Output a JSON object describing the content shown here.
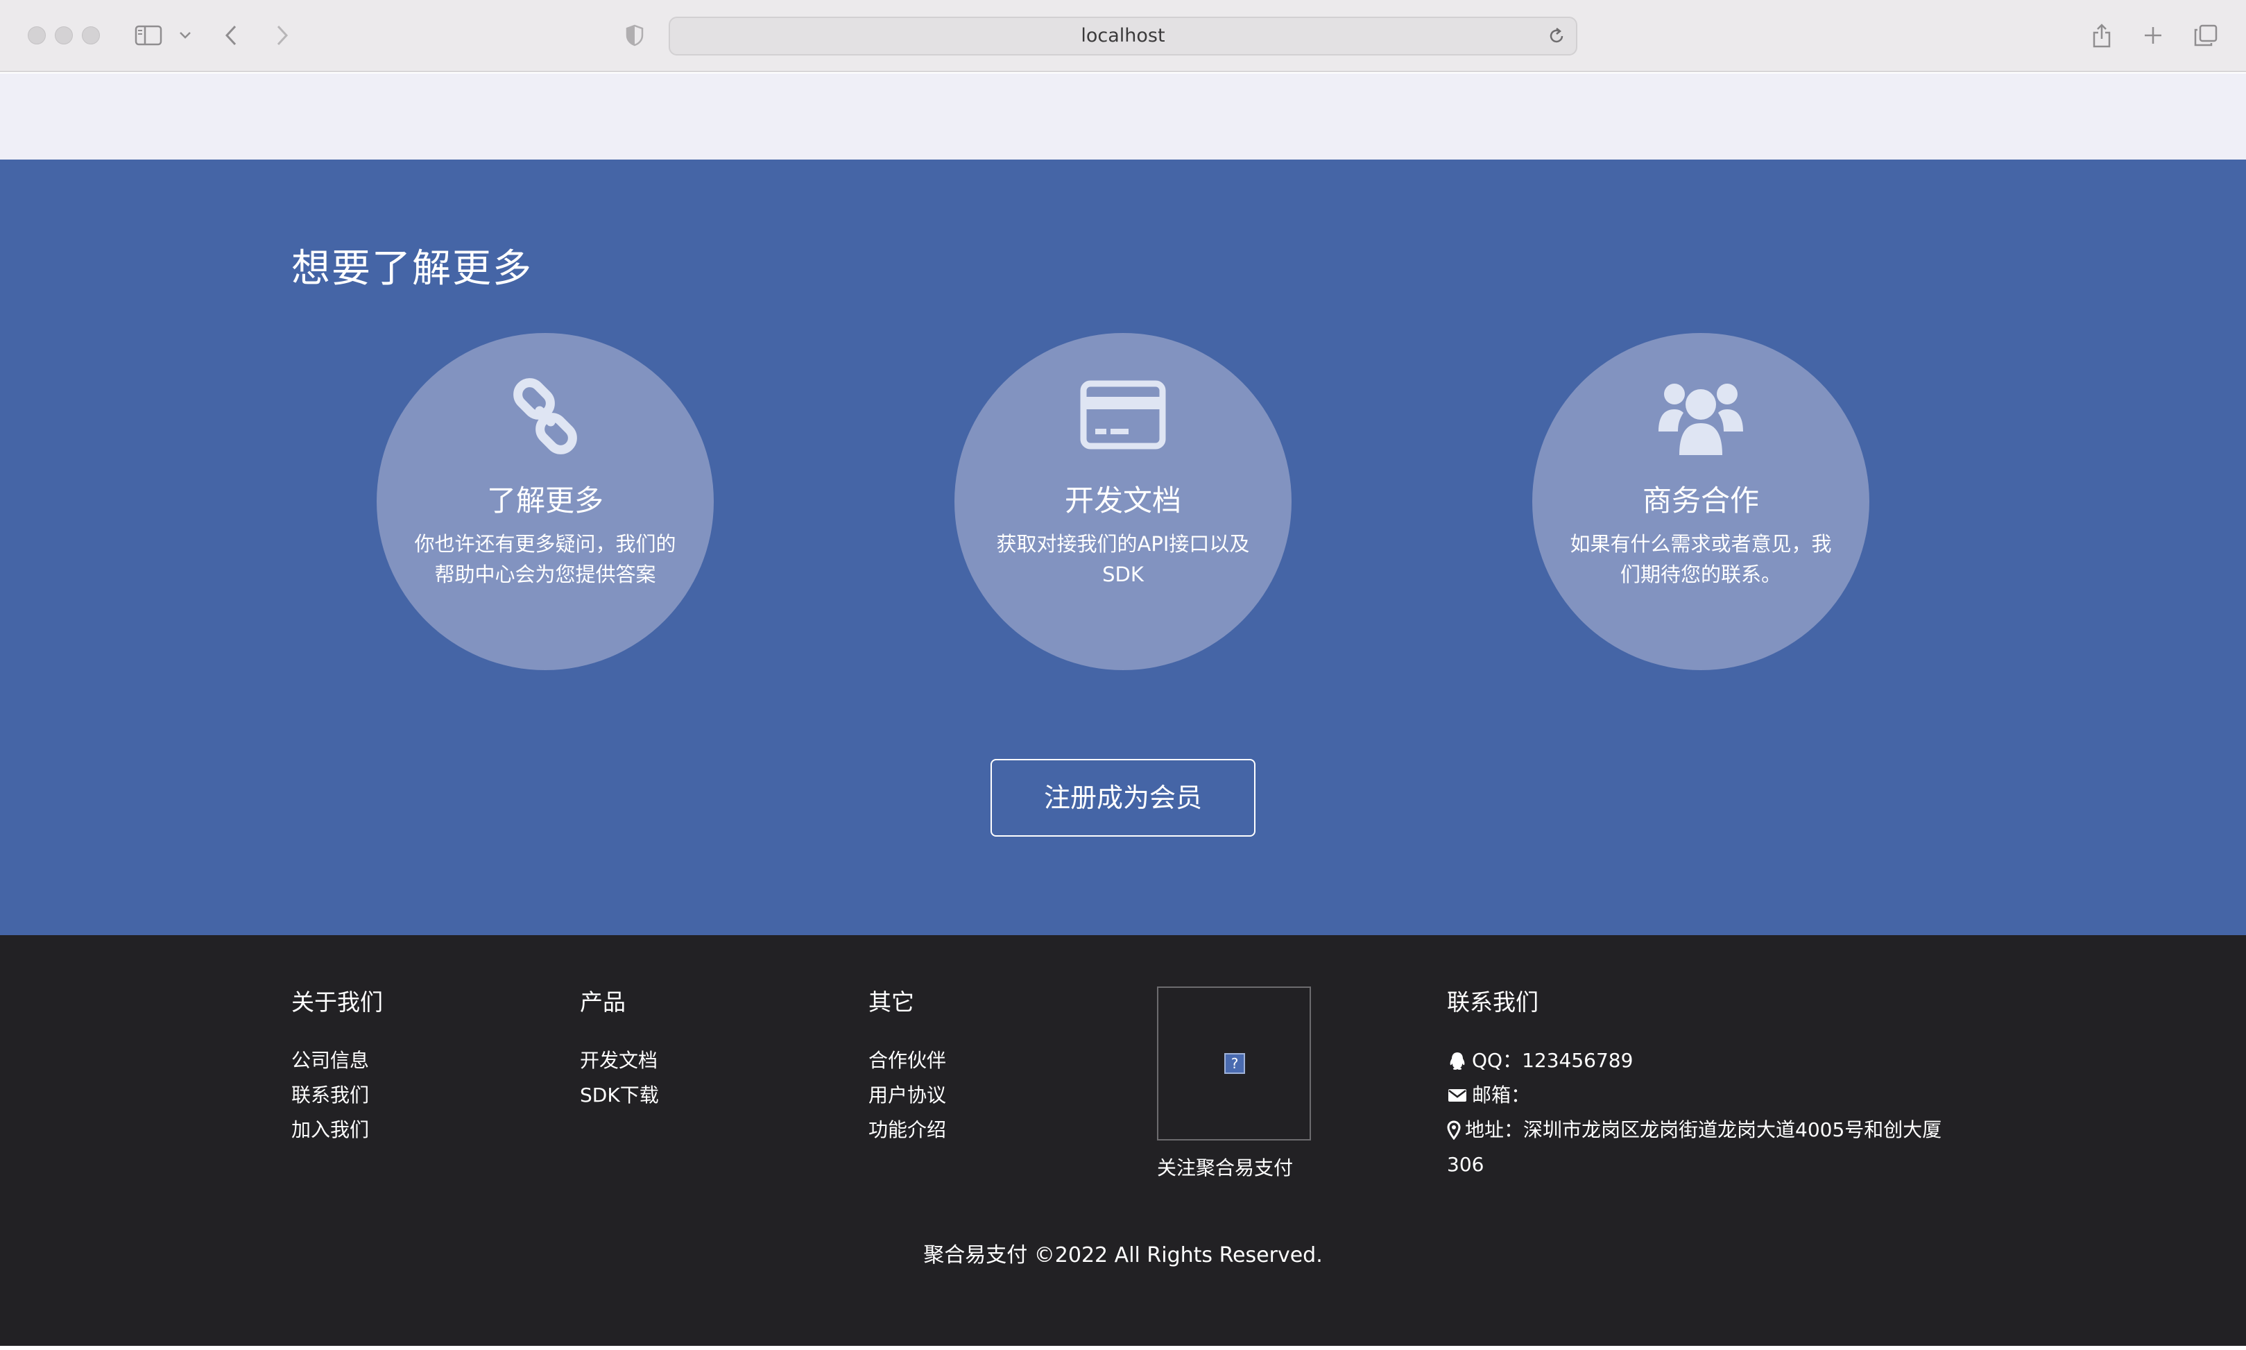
{
  "browser": {
    "url": "localhost"
  },
  "section": {
    "title": "想要了解更多",
    "cards": [
      {
        "icon": "link-icon",
        "title": "了解更多",
        "desc": "你也许还有更多疑问，我们的帮助中心会为您提供答案"
      },
      {
        "icon": "credit-card-icon",
        "title": "开发文档",
        "desc": "获取对接我们的API接口以及SDK"
      },
      {
        "icon": "users-icon",
        "title": "商务合作",
        "desc": "如果有什么需求或者意见，我们期待您的联系。"
      }
    ],
    "register_label": "注册成为会员",
    "colors": {
      "background": "#4565a6",
      "card": "#8293c0"
    }
  },
  "footer": {
    "about": {
      "title": "关于我们",
      "links": [
        "公司信息",
        "联系我们",
        "加入我们"
      ]
    },
    "products": {
      "title": "产品",
      "links": [
        "开发文档",
        "SDK下载"
      ]
    },
    "other": {
      "title": "其它",
      "links": [
        "合作伙伴",
        "用户协议",
        "功能介绍"
      ]
    },
    "qr_caption": "关注聚合易支付",
    "contact": {
      "title": "联系我们",
      "qq": "QQ：123456789",
      "email": "邮箱：",
      "address": "地址：深圳市龙岗区龙岗街道龙岗大道4005号和创大厦",
      "address_cont": "306"
    },
    "copyright": "聚合易支付  ©2022 All Rights Reserved.",
    "colors": {
      "background": "#222124"
    }
  }
}
